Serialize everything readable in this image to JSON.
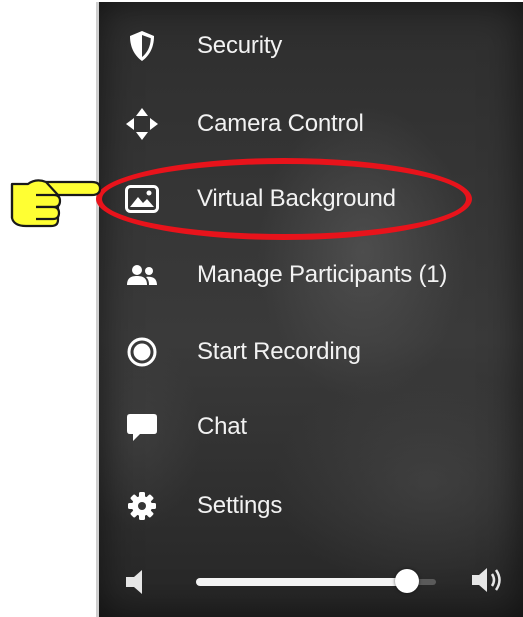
{
  "menu": {
    "items": [
      {
        "label": "Security",
        "icon": "shield-icon"
      },
      {
        "label": "Camera Control",
        "icon": "camera-control-arrows-icon"
      },
      {
        "label": "Virtual Background",
        "icon": "image-icon"
      },
      {
        "label": "Manage Participants (1)",
        "icon": "participants-icon"
      },
      {
        "label": "Start Recording",
        "icon": "record-icon"
      },
      {
        "label": "Chat",
        "icon": "chat-bubble-icon"
      },
      {
        "label": "Settings",
        "icon": "gear-icon"
      }
    ],
    "highlighted_item": "Virtual Background"
  },
  "volume": {
    "level": 0.88,
    "low_icon": "speaker-low-icon",
    "high_icon": "speaker-high-icon"
  },
  "annotation": {
    "pointer_icon": "pointing-hand-icon",
    "highlight_color": "#e8131b",
    "pointer_color": "#ffff33"
  },
  "colors": {
    "panel_bg": "#353535",
    "text": "#f2f2f2",
    "icon": "#ffffff"
  }
}
